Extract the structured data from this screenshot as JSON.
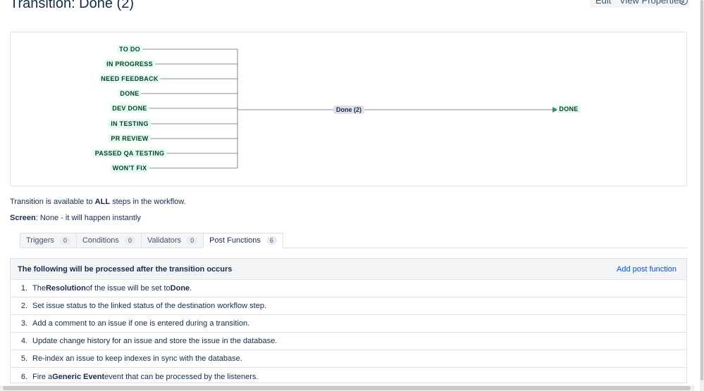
{
  "page": {
    "title": "Transition: Done (2)",
    "buttons": {
      "edit": "Edit",
      "view_properties": "View Properties"
    },
    "info_icon": "info-circle-icon"
  },
  "diagram": {
    "source_statuses": [
      "TO DO",
      "IN PROGRESS",
      "NEED FEEDBACK",
      "DONE",
      "DEV DONE",
      "IN TESTING",
      "PR REVIEW",
      "PASSED QA TESTING",
      "WON'T FIX"
    ],
    "transition_label": "Done (2)",
    "destination_status": "DONE",
    "colors": {
      "status_bg": "#e3fcef",
      "status_text": "#0b3d2b",
      "line": "#5e6c84"
    }
  },
  "availability": {
    "prefix": "Transition is available to ",
    "scope": "ALL",
    "suffix": " steps in the workflow."
  },
  "screen": {
    "label": "Screen",
    "value": ": None - it will happen instantly"
  },
  "tabs": [
    {
      "label": "Triggers",
      "count": "0"
    },
    {
      "label": "Conditions",
      "count": "0"
    },
    {
      "label": "Validators",
      "count": "0"
    },
    {
      "label": "Post Functions",
      "count": "6"
    }
  ],
  "post_functions": {
    "header": "The following will be processed after the transition occurs",
    "add_label": "Add post function",
    "items": [
      {
        "num": "1.",
        "parts": [
          {
            "t": "The "
          },
          {
            "t": "Resolution",
            "b": true
          },
          {
            "t": " of the issue will be set to "
          },
          {
            "t": "Done",
            "b": true
          },
          {
            "t": "."
          }
        ]
      },
      {
        "num": "2.",
        "parts": [
          {
            "t": "Set issue status to the linked status of the destination workflow step."
          }
        ]
      },
      {
        "num": "3.",
        "parts": [
          {
            "t": "Add a comment to an issue if one is entered during a transition."
          }
        ]
      },
      {
        "num": "4.",
        "parts": [
          {
            "t": "Update change history for an issue and store the issue in the database."
          }
        ]
      },
      {
        "num": "5.",
        "parts": [
          {
            "t": "Re-index an issue to keep indexes in sync with the database."
          }
        ]
      },
      {
        "num": "6.",
        "parts": [
          {
            "t": "Fire a "
          },
          {
            "t": "Generic Event",
            "b": true
          },
          {
            "t": " event that can be processed by the listeners."
          }
        ]
      }
    ]
  }
}
